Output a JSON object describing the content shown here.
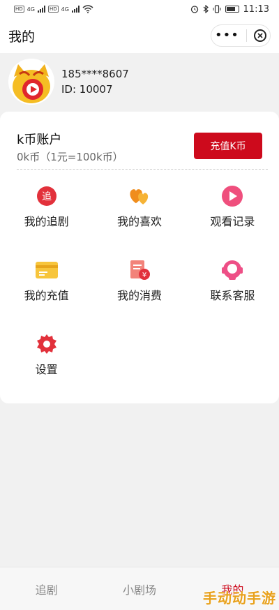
{
  "status_bar": {
    "hd1": "HD",
    "net1": "4G",
    "hd2": "HD",
    "net2": "4G",
    "time": "11:13"
  },
  "title_bar": {
    "title": "我的",
    "more": "•••"
  },
  "profile": {
    "phone": "185****8607",
    "id": "ID:  10007"
  },
  "coin": {
    "title": "k币账户",
    "balance": "0k币（1元=100k币）",
    "recharge_button": "充值K币"
  },
  "menu": {
    "items": [
      {
        "label": "我的追剧",
        "icon": "follow-drama-icon",
        "glyph": "追"
      },
      {
        "label": "我的喜欢",
        "icon": "heart-icon"
      },
      {
        "label": "观看记录",
        "icon": "play-history-icon"
      },
      {
        "label": "我的充值",
        "icon": "card-icon"
      },
      {
        "label": "我的消费",
        "icon": "bill-yen-icon",
        "glyph": "¥"
      },
      {
        "label": "联系客服",
        "icon": "customer-service-icon"
      },
      {
        "label": "设置",
        "icon": "settings-gear-icon"
      }
    ]
  },
  "tabbar": {
    "tabs": [
      {
        "label": "追剧"
      },
      {
        "label": "小剧场"
      },
      {
        "label": "我的"
      }
    ]
  },
  "watermark": "手动动手游",
  "colors": {
    "accent": "#cd0a1c",
    "background": "#f1f1f1",
    "card": "#ffffff"
  }
}
